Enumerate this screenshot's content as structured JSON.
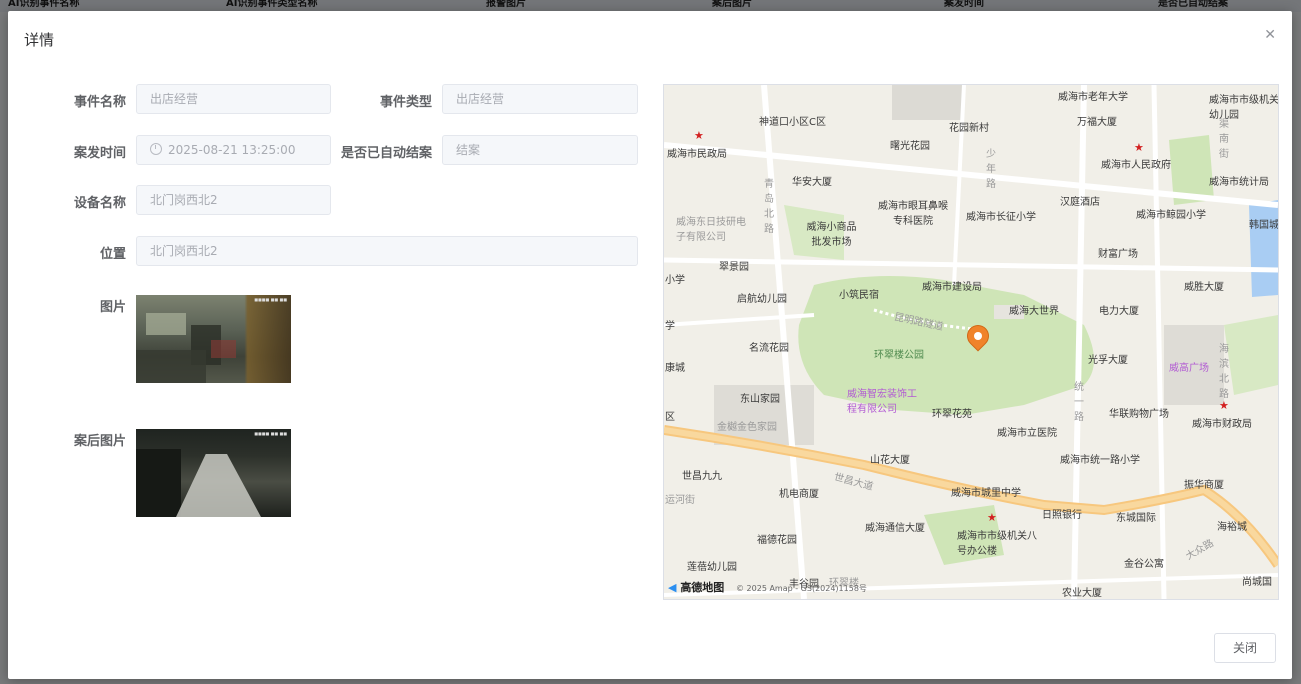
{
  "background": {
    "columns": [
      "AI识别事件名称",
      "AI识别事件类型名称",
      "报警图片",
      "案后图片",
      "案发时间",
      "是否已自动结案"
    ]
  },
  "dialog": {
    "title": "详情",
    "close_icon": "close-icon",
    "close_button": "关闭"
  },
  "form": {
    "event_name": {
      "label": "事件名称",
      "value": "出店经营"
    },
    "event_type": {
      "label": "事件类型",
      "value": "出店经营"
    },
    "incident_time": {
      "label": "案发时间",
      "value": "2025-08-21 13:25:00"
    },
    "auto_closed": {
      "label": "是否已自动结案",
      "value": "结案"
    },
    "device_name": {
      "label": "设备名称",
      "value": "北门岗西北2"
    },
    "location": {
      "label": "位置",
      "value": "北门岗西北2"
    },
    "image": {
      "label": "图片"
    },
    "after_image": {
      "label": "案后图片"
    }
  },
  "map": {
    "labels": {
      "l1": "神道口小区C区",
      "l2": "花园新村",
      "l3": "威海市老年大学",
      "l4": "万福大厦",
      "l5": "威海市市级机关幼儿园",
      "l6": "威海市民政局",
      "l7": "曙光花园",
      "l8": "威海市人民政府",
      "l9": "威海市统计局",
      "l10": "华安大厦",
      "l11": "威海市眼耳鼻喉专科医院",
      "l12": "威海市长征小学",
      "l13": "汉庭酒店",
      "l14": "威海市鲸园小学",
      "l15": "威海东日技研电子有限公司",
      "l16": "威海小商品批发市场",
      "l17": "韩国城",
      "l18": "财富广场",
      "l19": "翠景园",
      "l20": "小筑民宿",
      "l21": "威海市建设局",
      "l22": "威胜大厦",
      "l23": "启航幼儿园",
      "l24": "威海大世界",
      "l25": "电力大厦",
      "l26": "昆明路隧道",
      "l27": "名流花园",
      "l28": "环翠楼公园",
      "l29": "光孚大厦",
      "l30": "威高广场",
      "l31": "东山家园",
      "l32": "威海智宏装饰工程有限公司",
      "l33": "环翠花苑",
      "l34": "华联购物广场",
      "l35": "威海市财政局",
      "l36": "金樾金色家园",
      "l37": "威海市立医院",
      "l38": "山花大厦",
      "l39": "威海市统一路小学",
      "l40": "世昌九九",
      "l41": "机电商厦",
      "l42": "世昌大道",
      "l43": "威海市城里中学",
      "l44": "振华商厦",
      "l45": "日照银行",
      "l46": "东城国际",
      "l47": "海裕城",
      "l48": "福德花园",
      "l49": "威海通信大厦",
      "l50": "威海市市级机关八号办公楼",
      "l51": "大众路",
      "l52": "金谷公寓",
      "l53": "莲蓓幼儿园",
      "l54": "丰谷园",
      "l55": "农业大厦",
      "l56": "尚城国",
      "l57": "小学",
      "l58": "康城",
      "l59": "统一路",
      "l60": "少年路",
      "l61": "渠南街",
      "l62": "海滨北路",
      "l63": "青岛北路",
      "l64": "运河街",
      "l65": "环翠楼",
      "l66": "区",
      "l67": "学"
    },
    "logo": "高德地图",
    "copyright": "© 2025 Amap - GS(2024)1158号"
  }
}
